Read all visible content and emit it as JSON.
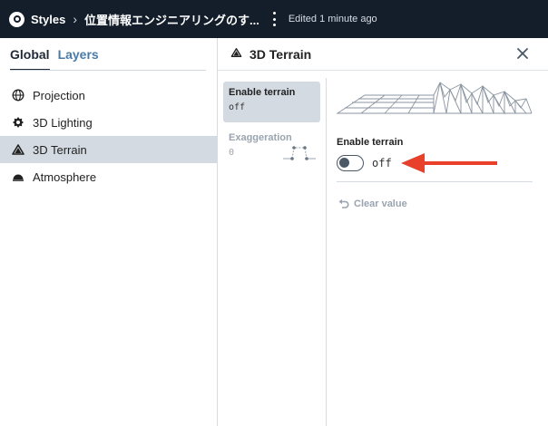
{
  "topbar": {
    "logo": "mapbox-logo-icon",
    "breadcrumb_root": "Styles",
    "breadcrumb_sep": "›",
    "style_name": "位置情報エンジニアリングのす...",
    "edited": "Edited 1 minute ago"
  },
  "left": {
    "tabs": [
      "Global",
      "Layers"
    ],
    "active_tab": "Global",
    "items": [
      {
        "label": "Projection",
        "icon": "globe-icon"
      },
      {
        "label": "3D Lighting",
        "icon": "lighting-icon"
      },
      {
        "label": "3D Terrain",
        "icon": "terrain-icon",
        "active": true
      },
      {
        "label": "Atmosphere",
        "icon": "atmosphere-icon"
      }
    ]
  },
  "panel": {
    "title": "3D Terrain",
    "properties": [
      {
        "name": "Enable terrain",
        "value": "off"
      },
      {
        "name": "Exaggeration",
        "value": "0"
      }
    ],
    "editor_label": "Enable terrain",
    "toggle_value": "off",
    "clear_label": "Clear value"
  },
  "colors": {
    "topbar": "#141e2b",
    "selected": "#d3dae2",
    "tab_inactive": "#4a7ba8",
    "arrow": "#e8402a"
  }
}
